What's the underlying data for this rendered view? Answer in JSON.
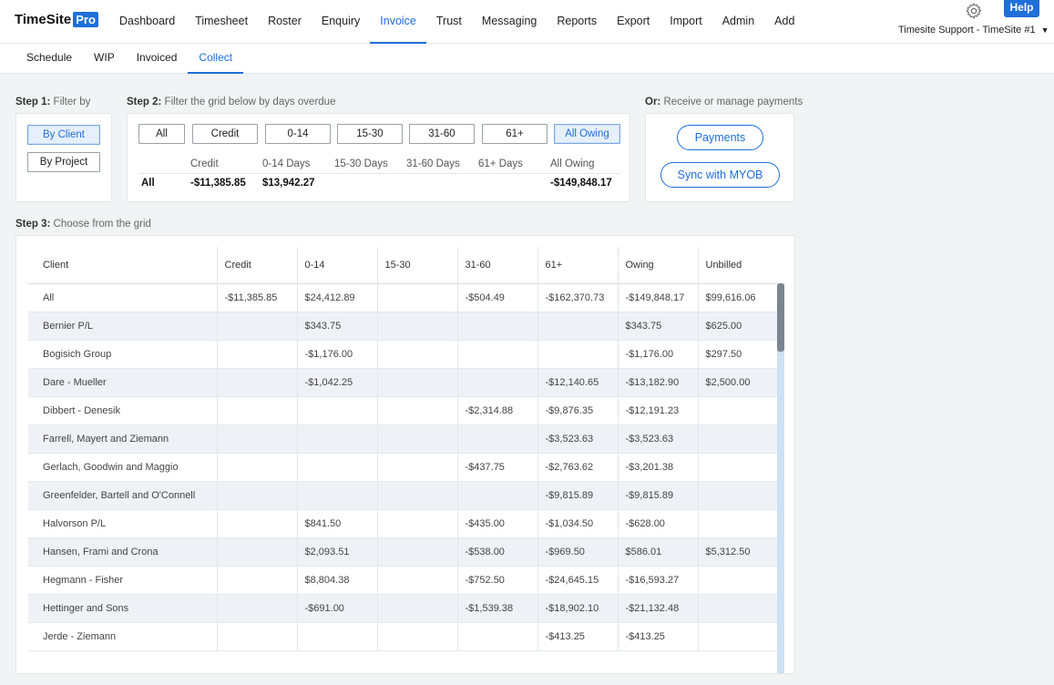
{
  "brand": {
    "name": "TimeSite",
    "badge": "Pro"
  },
  "nav": [
    "Dashboard",
    "Timesheet",
    "Roster",
    "Enquiry",
    "Invoice",
    "Trust",
    "Messaging",
    "Reports",
    "Export",
    "Import",
    "Admin",
    "Add"
  ],
  "help_label": "Help",
  "account_label": "Timesite Support - TimeSite #1",
  "subnav": [
    "Schedule",
    "WIP",
    "Invoiced",
    "Collect"
  ],
  "step1": {
    "bold": "Step 1:",
    "text": " Filter by",
    "by_client": "By Client",
    "by_project": "By Project"
  },
  "step2": {
    "bold": "Step 2:",
    "text": " Filter the grid below by days overdue",
    "buttons": [
      "All",
      "Credit",
      "0-14",
      "15-30",
      "31-60",
      "61+",
      "All Owing"
    ],
    "summary_labels": [
      "Credit",
      "0-14 Days",
      "15-30 Days",
      "31-60 Days",
      "61+ Days",
      "All Owing"
    ],
    "row_label": "All",
    "credit": "-$11,385.85",
    "d0_14": "$13,942.27",
    "all_owing": "-$149,848.17"
  },
  "step_or": {
    "bold": "Or:",
    "text": " Receive or manage payments",
    "payments": "Payments",
    "sync": "Sync with MYOB"
  },
  "step3": {
    "bold": "Step 3:",
    "text": " Choose from the grid"
  },
  "grid": {
    "columns": [
      "Client",
      "Credit",
      "0-14",
      "15-30",
      "31-60",
      "61+",
      "Owing",
      "Unbilled"
    ],
    "rows": [
      [
        "All",
        "-$11,385.85",
        "$24,412.89",
        "",
        "-$504.49",
        "-$162,370.73",
        "-$149,848.17",
        "$99,616.06"
      ],
      [
        "Bernier P/L",
        "",
        "$343.75",
        "",
        "",
        "",
        "$343.75",
        "$625.00"
      ],
      [
        "Bogisich Group",
        "",
        "-$1,176.00",
        "",
        "",
        "",
        "-$1,176.00",
        "$297.50"
      ],
      [
        "Dare - Mueller",
        "",
        "-$1,042.25",
        "",
        "",
        "-$12,140.65",
        "-$13,182.90",
        "$2,500.00"
      ],
      [
        "Dibbert - Denesik",
        "",
        "",
        "",
        "-$2,314.88",
        "-$9,876.35",
        "-$12,191.23",
        ""
      ],
      [
        "Farrell, Mayert and Ziemann",
        "",
        "",
        "",
        "",
        "-$3,523.63",
        "-$3,523.63",
        ""
      ],
      [
        "Gerlach, Goodwin and Maggio",
        "",
        "",
        "",
        "-$437.75",
        "-$2,763.62",
        "-$3,201.38",
        ""
      ],
      [
        "Greenfelder, Bartell and O'Connell",
        "",
        "",
        "",
        "",
        "-$9,815.89",
        "-$9,815.89",
        ""
      ],
      [
        "Halvorson P/L",
        "",
        "$841.50",
        "",
        "-$435.00",
        "-$1,034.50",
        "-$628.00",
        ""
      ],
      [
        "Hansen, Frami and Crona",
        "",
        "$2,093.51",
        "",
        "-$538.00",
        "-$969.50",
        "$586.01",
        "$5,312.50"
      ],
      [
        "Hegmann - Fisher",
        "",
        "$8,804.38",
        "",
        "-$752.50",
        "-$24,645.15",
        "-$16,593.27",
        ""
      ],
      [
        "Hettinger and Sons",
        "",
        "-$691.00",
        "",
        "-$1,539.38",
        "-$18,902.10",
        "-$21,132.48",
        ""
      ],
      [
        "Jerde - Ziemann",
        "",
        "",
        "",
        "",
        "-$413.25",
        "-$413.25",
        ""
      ]
    ]
  }
}
